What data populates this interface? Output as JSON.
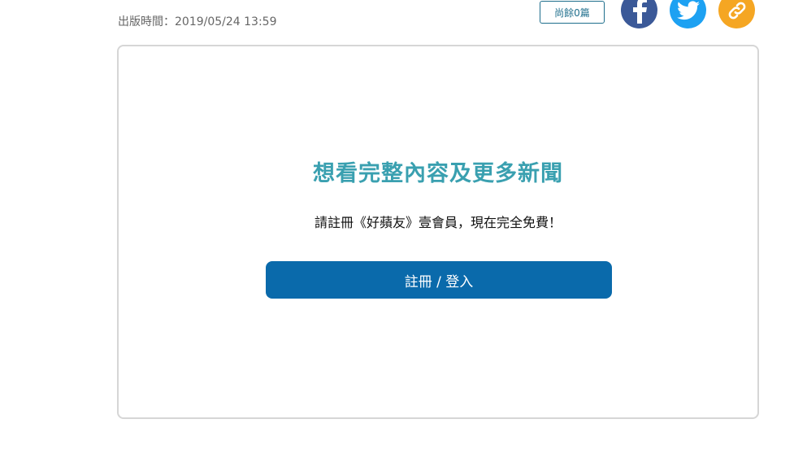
{
  "article": {
    "publish_time": "出版時間：2019/05/24 13:59"
  },
  "toolbar": {
    "remaining_label": "尚餘0篇"
  },
  "share": {
    "facebook_icon": "facebook-icon",
    "twitter_icon": "twitter-icon",
    "link_icon": "link-icon",
    "colors": {
      "facebook": "#3b5998",
      "twitter": "#1da1f2",
      "link": "#f5a623"
    }
  },
  "paywall": {
    "title": "想看完整內容及更多新聞",
    "subtitle": "請註冊《好蘋友》壹會員，現在完全免費！",
    "button_label": "註冊 / 登入"
  },
  "colors": {
    "accent_title": "#3aa0b0",
    "button_bg": "#0a6aab",
    "border": "#d6d6d6"
  }
}
